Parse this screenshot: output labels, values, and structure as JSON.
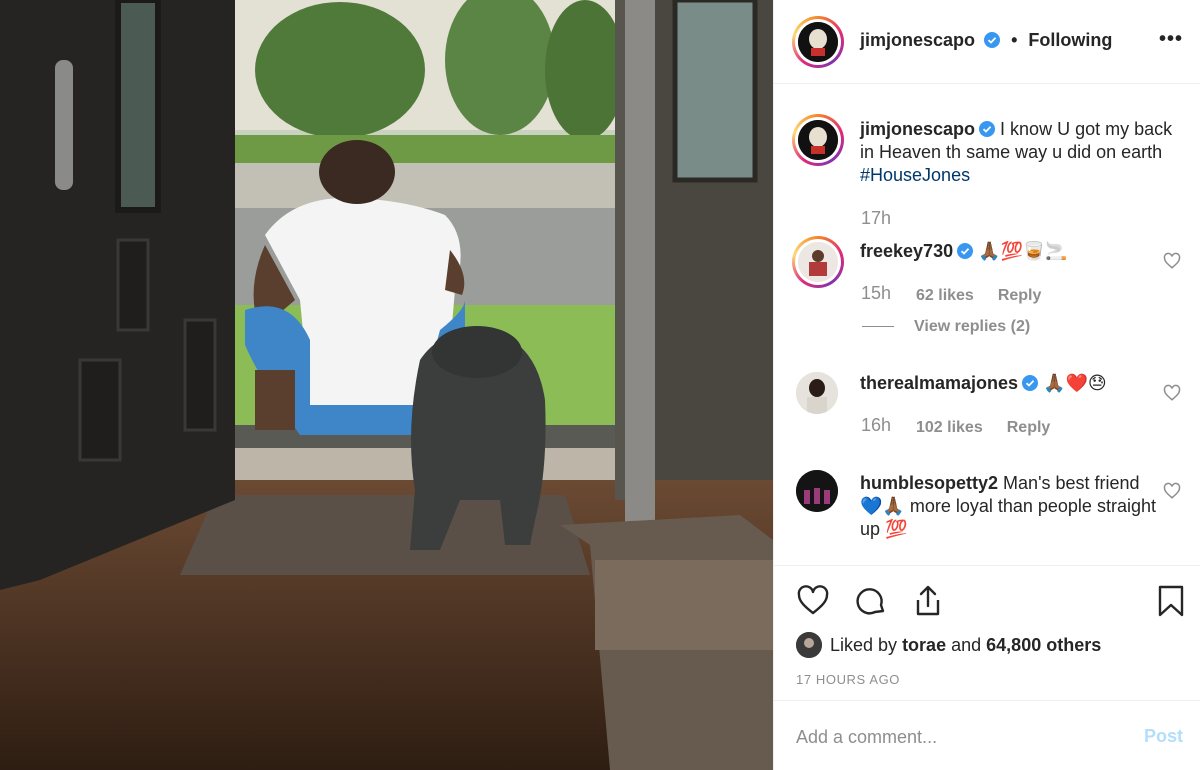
{
  "post": {
    "username": "jimjonescapo",
    "verified": true,
    "follow_status": "Following",
    "more_icon": "more-horizontal-icon",
    "caption_user": "jimjonescapo",
    "caption_text": "I know U got my back in Heaven th same way u did on earth",
    "caption_hashtag": "#HouseJones",
    "caption_time": "17h"
  },
  "comments": [
    {
      "username": "freekey730",
      "verified": true,
      "text": "🙏🏾💯🥃🚬",
      "time": "15h",
      "likes": "62 likes",
      "reply_label": "Reply",
      "view_replies": "View replies (2)"
    },
    {
      "username": "therealmamajones",
      "verified": true,
      "text": "🙏🏾❤️😓",
      "time": "16h",
      "likes": "102 likes",
      "reply_label": "Reply"
    },
    {
      "username": "humblesopetty2",
      "verified": false,
      "text": "Man's best friend 💙🙏🏾 more loyal than people straight up 💯"
    }
  ],
  "actions": {
    "icons": [
      "heart-icon",
      "comment-icon",
      "share-icon",
      "bookmark-icon"
    ],
    "liked_by_prefix": "Liked by",
    "liked_by_user": "torae",
    "liked_by_and": "and",
    "liked_by_others": "64,800 others",
    "timestamp": "17 HOURS AGO"
  },
  "comment_box": {
    "placeholder": "Add a comment...",
    "post_label": "Post"
  },
  "colors": {
    "verified_blue": "#3897f0",
    "hashtag": "#00376b",
    "muted": "#8e8e8e",
    "post_disabled": "#b2dffc"
  }
}
